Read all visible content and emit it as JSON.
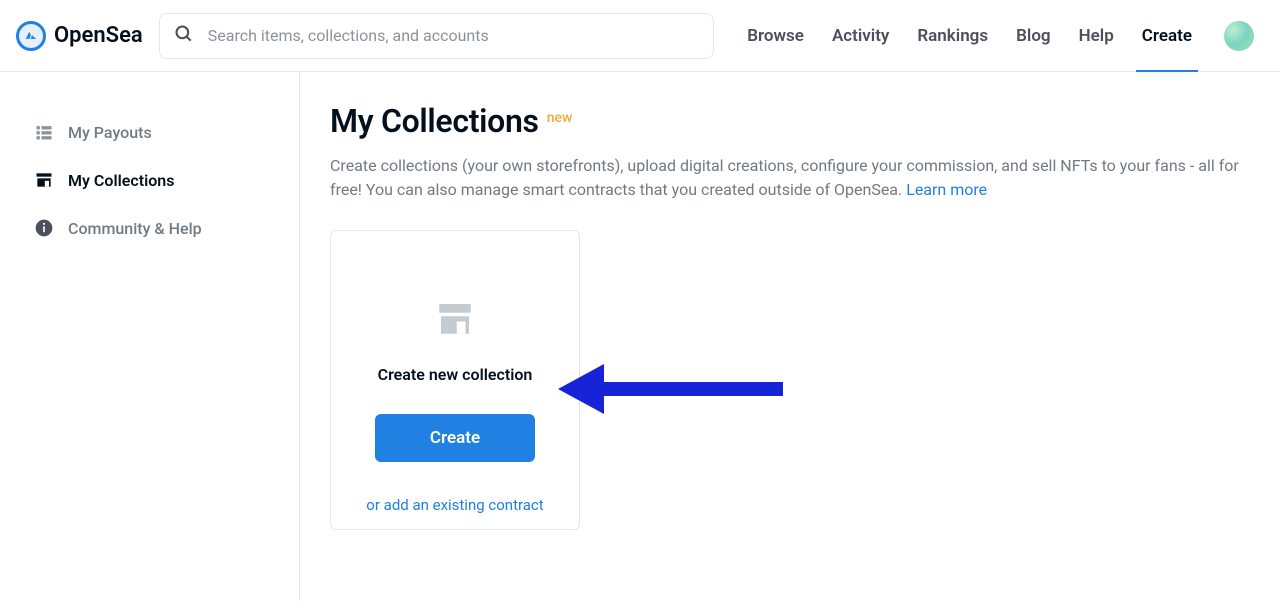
{
  "brand": "OpenSea",
  "search": {
    "placeholder": "Search items, collections, and accounts"
  },
  "nav": {
    "items": [
      "Browse",
      "Activity",
      "Rankings",
      "Blog",
      "Help",
      "Create"
    ],
    "activeIndex": 5
  },
  "sidebar": {
    "items": [
      {
        "label": "My Payouts",
        "icon": "list-icon"
      },
      {
        "label": "My Collections",
        "icon": "storefront-icon"
      },
      {
        "label": "Community & Help",
        "icon": "info-icon"
      }
    ],
    "activeIndex": 1
  },
  "page": {
    "title": "My Collections",
    "badge": "new",
    "desc_part1": "Create collections (your own storefronts), upload digital creations, configure your commission, and sell NFTs to your fans - all for free! You can also manage smart contracts that you created outside of OpenSea. ",
    "learn_more": "Learn more"
  },
  "card": {
    "title": "Create new collection",
    "button": "Create",
    "alt_link": "or add an existing contract"
  },
  "colors": {
    "primary": "#2081e2",
    "annotation": "#1623d6"
  }
}
